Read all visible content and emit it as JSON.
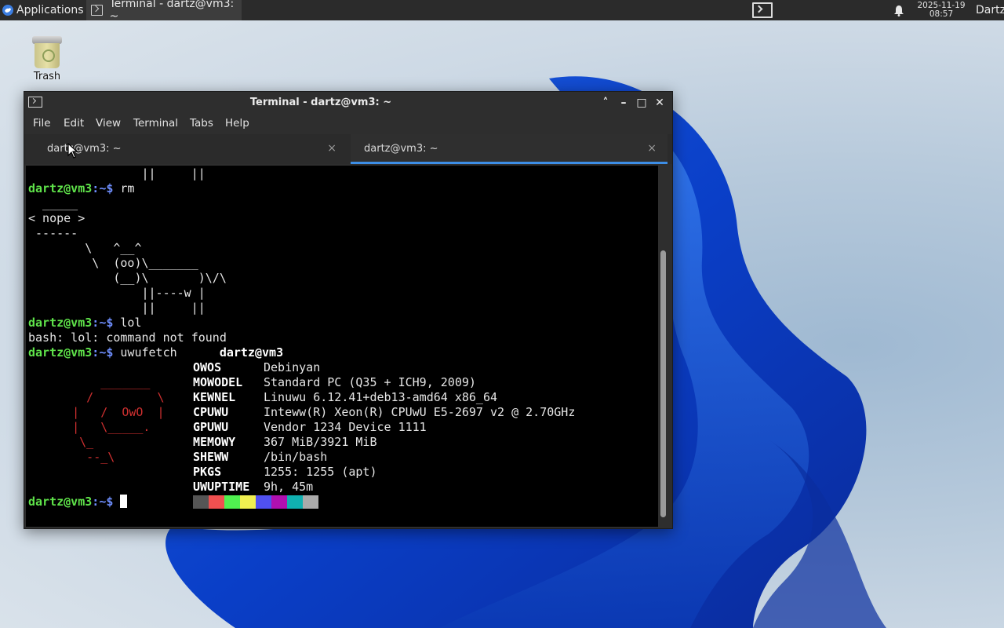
{
  "panel": {
    "applications_label": "Applications",
    "applications_sep": "≡",
    "task_title": "Terminal - dartz@vm3: ~",
    "clock_date": "2025-11-19",
    "clock_time": "08:57",
    "user_label": "Dartz"
  },
  "desktop": {
    "trash_label": "Trash"
  },
  "window": {
    "title": "Terminal - dartz@vm3: ~",
    "controls": {
      "up": "˄",
      "minimize": "–",
      "maximize": "□",
      "close": "✕"
    },
    "menu": [
      "File",
      "Edit",
      "View",
      "Terminal",
      "Tabs",
      "Help"
    ],
    "tabs": [
      {
        "label": "dartz@vm3: ~",
        "active": false,
        "close": "×"
      },
      {
        "label": "dartz@vm3: ~",
        "active": true,
        "close": "×"
      }
    ]
  },
  "terminal": {
    "prompt_user": "dartz@vm3",
    "prompt_sep": ":",
    "prompt_path": "~",
    "prompt_dollar": "$ ",
    "line0": "                ||     ||",
    "cmd_rm": "rm",
    "cow_top": "  _____",
    "cow_say": "< nope >",
    "cow_under": " ------",
    "cow1": "        \\   ^__^",
    "cow2": "         \\  (oo)\\_______",
    "cow3": "            (__)\\       )\\/\\",
    "cow4": "                ||----w |",
    "cow5": "                ||     ||",
    "cmd_lol": "lol",
    "err_lol": "bash: lol: command not found",
    "cmd_fetch": "uwufetch      ",
    "fetch_user": "dartz@vm3",
    "logo": [
      "",
      "",
      "        _______",
      "      /         \\",
      "    |   /  OwO  |",
      "    |   \\_____.",
      "     \\_",
      "      --_\\"
    ],
    "info": [
      {
        "key": "OWOS",
        "val": "Debinyan"
      },
      {
        "key": "MOWODEL",
        "val": "Standard PC (Q35 + ICH9, 2009)"
      },
      {
        "key": "KEWNEL",
        "val": "Linuwu 6.12.41+deb13-amd64 x86_64"
      },
      {
        "key": "CPUWU",
        "val": "Inteww(R) Xeon(R) CPUwU E5-2697 v2 @ 2.70GHz"
      },
      {
        "key": "GPUWU",
        "val": "Vendor 1234 Device 1111"
      },
      {
        "key": "MEMOWY",
        "val": "367 MiB/3921 MiB"
      },
      {
        "key": "SHEWW",
        "val": "/bin/bash"
      },
      {
        "key": "PKGS",
        "val": "1255: 1255 (apt)"
      },
      {
        "key": "UWUPTIME",
        "val": "9h, 45m"
      }
    ],
    "palette": [
      "#555555",
      "#f05050",
      "#50f050",
      "#f0f050",
      "#5050f0",
      "#b010b0",
      "#10b0b0",
      "#aaaaaa"
    ]
  }
}
